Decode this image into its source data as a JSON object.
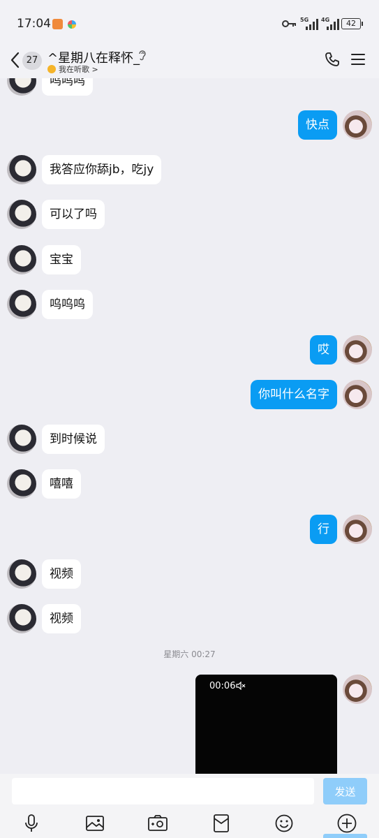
{
  "status_bar": {
    "time": "17:04",
    "net_1": "5G",
    "net_2": "4G",
    "battery": "42"
  },
  "header": {
    "unread_count": "27",
    "title": "^星期八在释怀_",
    "status_text": "我在听歌 >"
  },
  "messages": [
    {
      "side": "left",
      "text": "呜呜呜"
    },
    {
      "side": "right",
      "text": "快点"
    },
    {
      "side": "left",
      "text": "我答应你舔jb，吃jy"
    },
    {
      "side": "left",
      "text": "可以了吗"
    },
    {
      "side": "left",
      "text": "宝宝"
    },
    {
      "side": "left",
      "text": "呜呜呜"
    },
    {
      "side": "right",
      "text": "哎"
    },
    {
      "side": "right",
      "text": "你叫什么名字"
    },
    {
      "side": "left",
      "text": "到时候说"
    },
    {
      "side": "left",
      "text": "嘻嘻"
    },
    {
      "side": "right",
      "text": "行"
    },
    {
      "side": "left",
      "text": "视频"
    },
    {
      "side": "left",
      "text": "视频"
    }
  ],
  "timestamp": "星期六 00:27",
  "video_message": {
    "duration": "00:06"
  },
  "input": {
    "value": "",
    "placeholder": "",
    "send_label": "发送"
  },
  "toolbar_icons": [
    "microphone-icon",
    "image-icon",
    "camera-icon",
    "red-envelope-icon",
    "emoji-icon",
    "plus-icon"
  ],
  "colors": {
    "accent": "#0a9cf3",
    "send_disabled": "#8fcdfa",
    "background": "#eeeef3"
  }
}
